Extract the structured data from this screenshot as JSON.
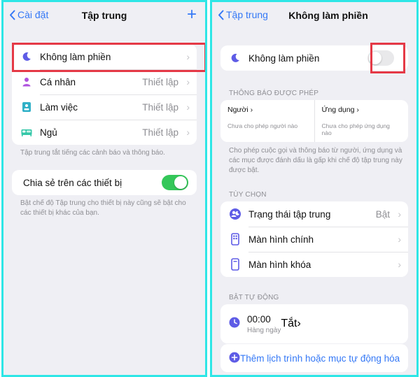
{
  "left": {
    "nav": {
      "back_label": "Cài đặt",
      "title": "Tập trung",
      "add_symbol": "+"
    },
    "focus_modes": [
      {
        "label": "Không làm phiền",
        "value": ""
      },
      {
        "label": "Cá nhân",
        "value": "Thiết lập"
      },
      {
        "label": "Làm việc",
        "value": "Thiết lập"
      },
      {
        "label": "Ngủ",
        "value": "Thiết lập"
      }
    ],
    "modes_footnote": "Tập trung tắt tiếng các cảnh báo và thông báo.",
    "share_label": "Chia sẻ trên các thiết bị",
    "share_on": true,
    "share_footnote": "Bật chế độ Tập trung cho thiết bị này cũng sẽ bật cho các thiết bị khác của bạn."
  },
  "right": {
    "nav": {
      "back_label": "Tập trung",
      "title": "Không làm phiền"
    },
    "dnd_label": "Không làm phiền",
    "dnd_on": false,
    "allowed_header": "THÔNG BÁO ĐƯỢC PHÉP",
    "allowed": {
      "people_title": "Người",
      "people_sub": "Chưa cho phép người nào",
      "apps_title": "Ứng dụng",
      "apps_sub": "Chưa cho phép ứng dụng nào"
    },
    "allowed_footnote": "Cho phép cuộc gọi và thông báo từ người, ứng dụng và các mục được đánh dấu là gấp khi chế độ tập trung này được bật.",
    "options_header": "TÙY CHỌN",
    "options": [
      {
        "label": "Trạng thái tập trung",
        "value": "Bật"
      },
      {
        "label": "Màn hình chính",
        "value": ""
      },
      {
        "label": "Màn hình khóa",
        "value": ""
      }
    ],
    "auto_header": "BẬT TỰ ĐỘNG",
    "schedule": {
      "time": "00:00",
      "days": "Hàng ngày",
      "value": "Tắt"
    },
    "add_label": "Thêm lịch trình hoặc mục tự động hóa"
  },
  "colors": {
    "accent": "#3478f6",
    "toggle_on": "#34c759",
    "highlight": "#e53946",
    "purple": "#5e5ce6",
    "frame": "#2ee6e6"
  }
}
